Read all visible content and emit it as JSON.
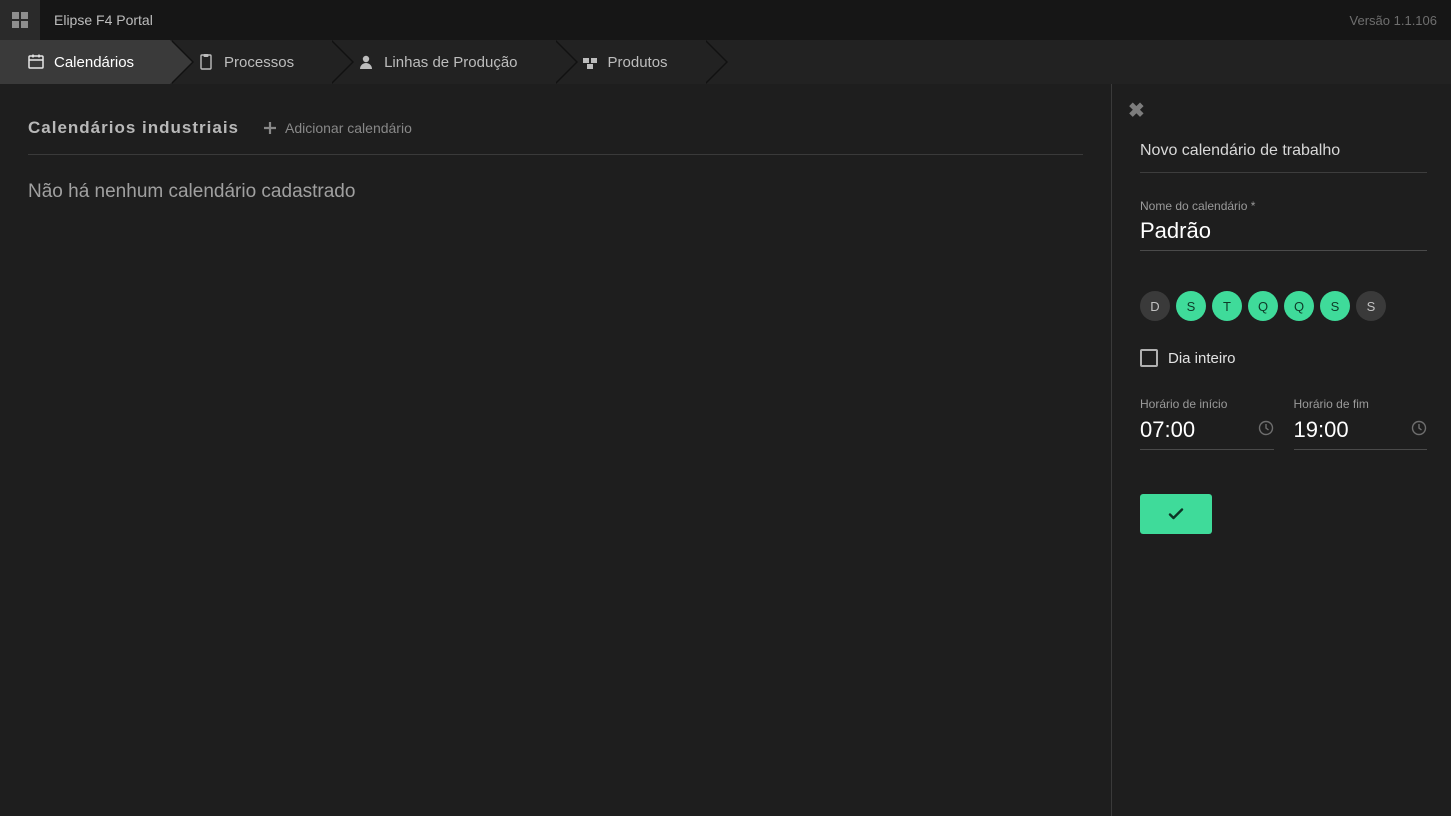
{
  "app": {
    "title": "Elipse F4 Portal",
    "version": "Versão 1.1.106"
  },
  "nav": {
    "items": [
      {
        "label": "Calendários",
        "icon": "calendar",
        "active": true
      },
      {
        "label": "Processos",
        "icon": "clipboard",
        "active": false
      },
      {
        "label": "Linhas de Produção",
        "icon": "user",
        "active": false
      },
      {
        "label": "Produtos",
        "icon": "package",
        "active": false
      }
    ]
  },
  "main": {
    "title": "Calendários industriais",
    "add_label": "Adicionar calendário",
    "empty_message": "Não há nenhum calendário cadastrado"
  },
  "panel": {
    "title": "Novo calendário de trabalho",
    "name_label": "Nome do calendário *",
    "name_value": "Padrão",
    "days": [
      {
        "letter": "D",
        "selected": false
      },
      {
        "letter": "S",
        "selected": true
      },
      {
        "letter": "T",
        "selected": true
      },
      {
        "letter": "Q",
        "selected": true
      },
      {
        "letter": "Q",
        "selected": true
      },
      {
        "letter": "S",
        "selected": true
      },
      {
        "letter": "S",
        "selected": false
      }
    ],
    "all_day_label": "Dia inteiro",
    "all_day_checked": false,
    "start_label": "Horário de início",
    "start_value": "07:00",
    "end_label": "Horário de fim",
    "end_value": "19:00"
  }
}
